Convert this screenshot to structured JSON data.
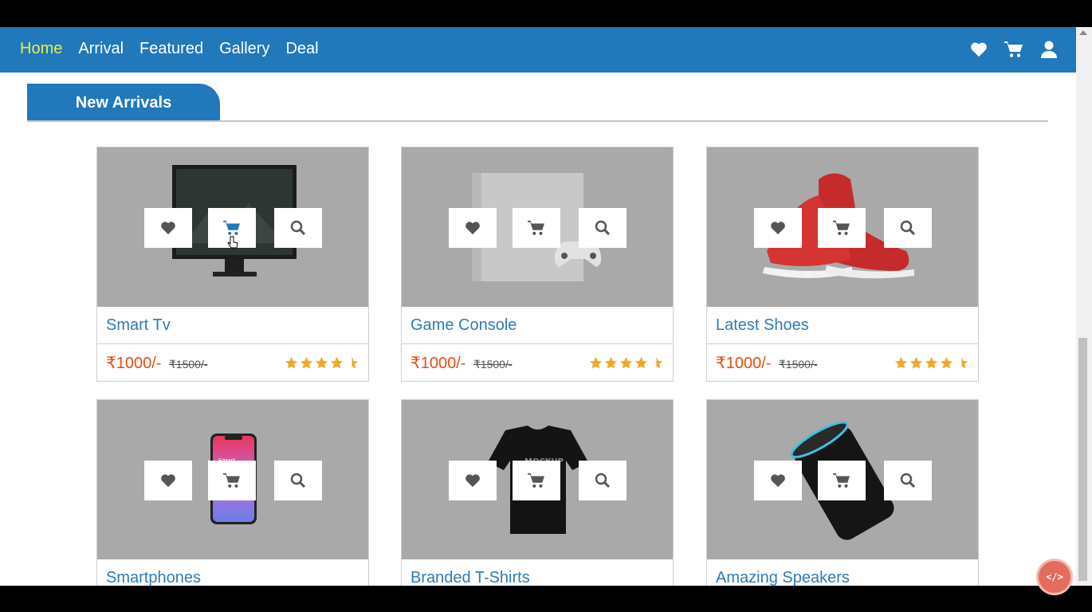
{
  "nav": {
    "links": [
      "Home",
      "Arrival",
      "Featured",
      "Gallery",
      "Deal"
    ],
    "active": "Home",
    "icons": [
      "heart-icon",
      "cart-icon",
      "user-icon"
    ]
  },
  "section": {
    "title": "New Arrivals"
  },
  "products": [
    {
      "title": "Smart Tv",
      "price": "₹1000/-",
      "old_price": "₹1500/-",
      "rating": 4.5
    },
    {
      "title": "Game Console",
      "price": "₹1000/-",
      "old_price": "₹1500/-",
      "rating": 4.5
    },
    {
      "title": "Latest Shoes",
      "price": "₹1000/-",
      "old_price": "₹1500/-",
      "rating": 4.5
    },
    {
      "title": "Smartphones"
    },
    {
      "title": "Branded T-Shirts"
    },
    {
      "title": "Amazing Speakers"
    }
  ],
  "tshirt_print": "MOCKUP",
  "phone_screen_text": "Smart",
  "colors": {
    "brand": "#2178bb",
    "active_nav": "#e4f04a",
    "price": "#e84d0e",
    "star": "#f5a623",
    "title": "#2e7bb7"
  },
  "badge": "</>"
}
